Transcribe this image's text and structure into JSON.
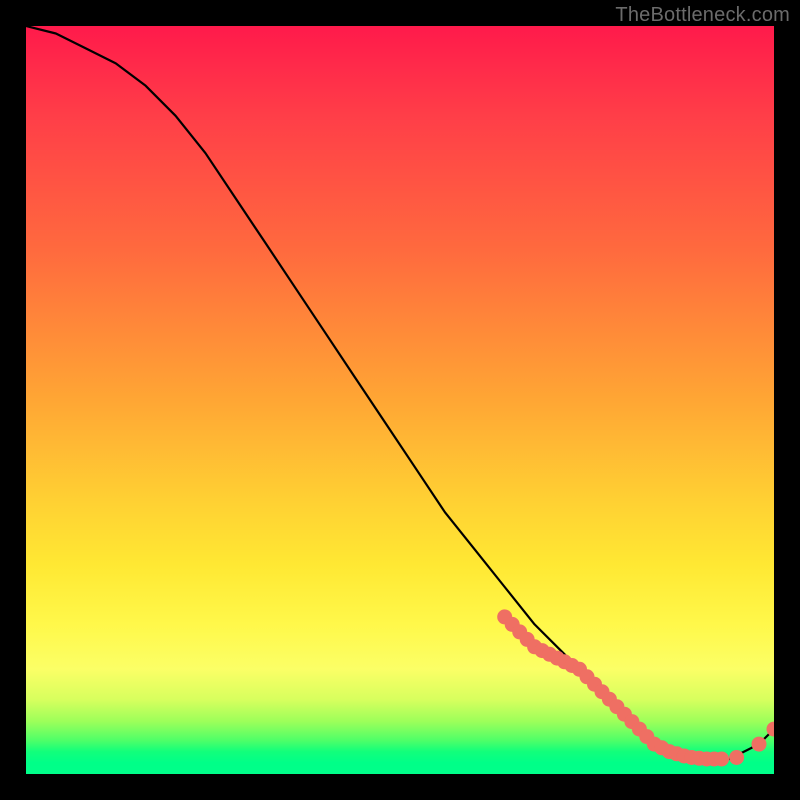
{
  "watermark": "TheBottleneck.com",
  "chart_data": {
    "type": "line",
    "title": "",
    "xlabel": "",
    "ylabel": "",
    "xlim": [
      0,
      100
    ],
    "ylim": [
      0,
      100
    ],
    "grid": false,
    "legend": false,
    "annotations": [],
    "series": [
      {
        "name": "curve",
        "style": "line",
        "color": "#000000",
        "x": [
          0,
          4,
          8,
          12,
          16,
          20,
          24,
          28,
          32,
          36,
          40,
          44,
          48,
          52,
          56,
          60,
          64,
          68,
          72,
          76,
          80,
          82,
          84,
          86,
          88,
          90,
          92,
          94,
          96,
          98,
          100
        ],
        "y": [
          100,
          99,
          97,
          95,
          92,
          88,
          83,
          77,
          71,
          65,
          59,
          53,
          47,
          41,
          35,
          30,
          25,
          20,
          16,
          12,
          8,
          6,
          4,
          3,
          2,
          2,
          2,
          2,
          3,
          4,
          6
        ]
      },
      {
        "name": "markers",
        "style": "scatter",
        "color": "#ef6f63",
        "x": [
          64,
          65,
          66,
          67,
          68,
          69,
          70,
          71,
          72,
          73,
          74,
          75,
          76,
          77,
          78,
          79,
          80,
          81,
          82,
          83,
          84,
          85,
          86,
          87,
          88,
          89,
          90,
          91,
          92,
          93,
          95,
          98,
          100
        ],
        "y": [
          21,
          20,
          19,
          18,
          17,
          16.5,
          16,
          15.5,
          15,
          14.5,
          14,
          13,
          12,
          11,
          10,
          9,
          8,
          7,
          6,
          5,
          4,
          3.5,
          3,
          2.7,
          2.4,
          2.2,
          2.1,
          2,
          2,
          2,
          2.2,
          4,
          6
        ]
      }
    ]
  }
}
